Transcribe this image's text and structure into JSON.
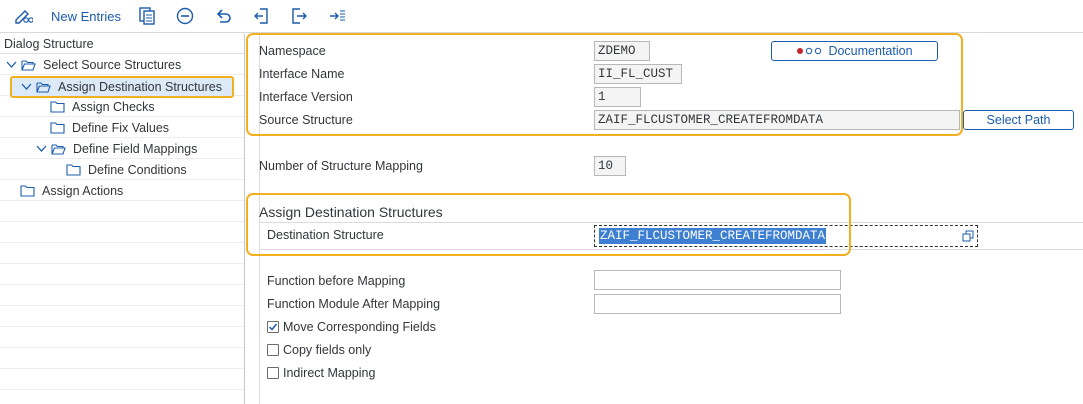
{
  "toolbar": {
    "new_entries_label": "New Entries",
    "icons": [
      "pencil-glasses-icon",
      "copy-icon",
      "delete-icon",
      "undo-icon",
      "select-all-icon",
      "deselect-icon",
      "export-icon"
    ]
  },
  "dialog_structure": {
    "header": "Dialog Structure",
    "items": [
      {
        "label": "Select Source Structures",
        "expanded": true,
        "selected": false
      },
      {
        "label": "Assign Destination Structures",
        "expanded": true,
        "selected": true
      },
      {
        "label": "Assign Checks",
        "expanded": false,
        "selected": false
      },
      {
        "label": "Define Fix Values",
        "expanded": false,
        "selected": false
      },
      {
        "label": "Define Field Mappings",
        "expanded": true,
        "selected": false
      },
      {
        "label": "Define Conditions",
        "expanded": false,
        "selected": false
      },
      {
        "label": "Assign Actions",
        "expanded": false,
        "selected": false
      }
    ]
  },
  "header_fields": {
    "namespace_label": "Namespace",
    "namespace_value": "ZDEMO",
    "interface_name_label": "Interface Name",
    "interface_name_value": "II_FL_CUST",
    "interface_version_label": "Interface Version",
    "interface_version_value": "1",
    "source_structure_label": "Source Structure",
    "source_structure_value": "ZAIF_FLCUSTOMER_CREATEFROMDATA",
    "documentation_button": "Documentation",
    "select_path_button": "Select Path"
  },
  "mapping_count": {
    "label": "Number of Structure Mapping",
    "value": "10"
  },
  "destination": {
    "section_title": "Assign Destination Structures",
    "structure_label": "Destination Structure",
    "structure_value": "ZAIF_FLCUSTOMER_CREATEFROMDATA",
    "function_before_label": "Function before Mapping",
    "function_before_value": "",
    "function_after_label": "Function Module After Mapping",
    "function_after_value": "",
    "move_corresponding_label": "Move Corresponding Fields",
    "move_corresponding_checked": true,
    "copy_fields_label": "Copy fields only",
    "copy_fields_checked": false,
    "indirect_mapping_label": "Indirect Mapping",
    "indirect_mapping_checked": false
  },
  "colors": {
    "accent": "#1c5cad",
    "highlight_frame": "#f2b01e",
    "selection": "#3d7fd0"
  }
}
